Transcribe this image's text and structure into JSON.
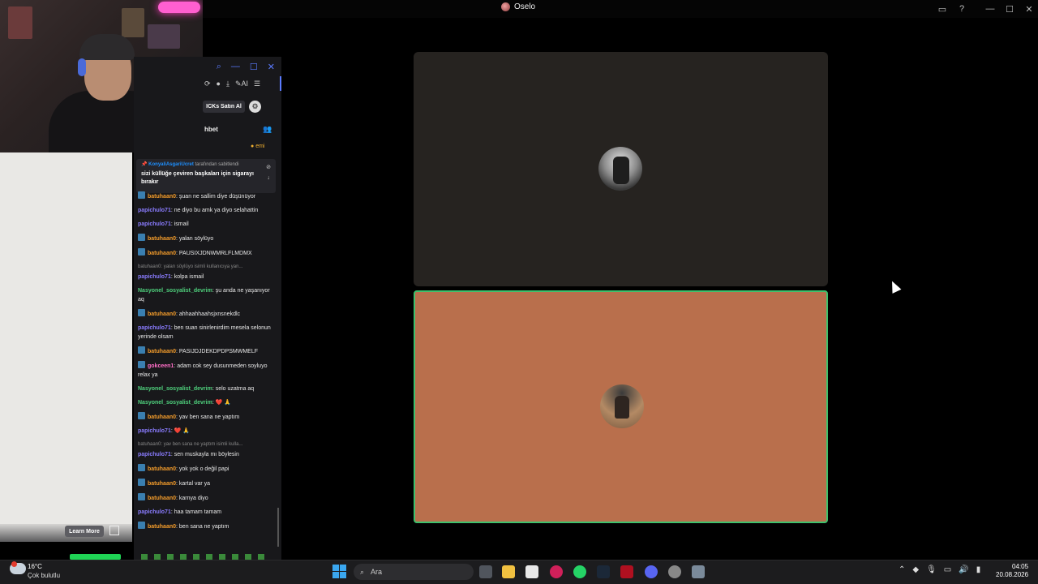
{
  "window": {
    "title": "Oselo",
    "controls": {
      "minimize": "—",
      "maximize": "☐",
      "close": "✕"
    }
  },
  "panel": {
    "buy_label": "ICKs Satın Al",
    "chat_title": "hbet",
    "points": "emi",
    "ai_label": "AI",
    "pinned": {
      "user": "KonyaliAsgariUcret",
      "suffix": "tarafından sabitlendi",
      "message": "sizi küllüğe çeviren başkaları için sigarayı bırakır"
    },
    "messages": [
      {
        "user": "batuhaan0",
        "color": "orange",
        "badge": true,
        "text": "şuan ne sallim diye düşünüyor"
      },
      {
        "user": "papichulo71",
        "color": "purple",
        "badge": false,
        "text": "ne diyo bu amk ya diyo selahattin"
      },
      {
        "user": "papichulo71",
        "color": "purple",
        "badge": false,
        "text": "ismail"
      },
      {
        "user": "batuhaan0",
        "color": "orange",
        "badge": true,
        "text": "yalan söylüyo"
      },
      {
        "user": "batuhaan0",
        "color": "orange",
        "badge": true,
        "text": "PAUSIXJDNWMRLFLMDMX"
      },
      {
        "reply": "batuhaan0: yalan söylüyo isimli kullanıcıya yan..."
      },
      {
        "user": "papichulo71",
        "color": "purple",
        "badge": false,
        "text": "kolpa ismail"
      },
      {
        "user": "Nasyonel_sosyalist_devrim",
        "color": "green",
        "badge": false,
        "text": "şu anda ne yaşanıyor aq"
      },
      {
        "user": "batuhaan0",
        "color": "orange",
        "badge": true,
        "text": "ahhaahhaahsjxnsnekdlc"
      },
      {
        "user": "papichulo71",
        "color": "purple",
        "badge": false,
        "text": "ben suan sinirlenirdim mesela selonun yerinde olsam"
      },
      {
        "user": "batuhaan0",
        "color": "orange",
        "badge": true,
        "text": "PASIJDJDEKDPDPSMWMELF"
      },
      {
        "user": "gokceen1",
        "color": "pink",
        "badge": true,
        "text": "adam cok sey dusunmeden soyluyo relax ya"
      },
      {
        "user": "Nasyonel_sosyalist_devrim",
        "color": "green",
        "badge": false,
        "text": "selo uzatma aq"
      },
      {
        "user": "Nasyonel_sosyalist_devrim",
        "color": "green",
        "badge": false,
        "text": "❤️ 🙏"
      },
      {
        "user": "batuhaan0",
        "color": "orange",
        "badge": true,
        "text": "yav ben sana ne yaptım"
      },
      {
        "user": "papichulo71",
        "color": "purple",
        "badge": false,
        "text": "❤️ 🙏"
      },
      {
        "reply": "batuhaan0: yav ben sana ne yaptım isimli kulla..."
      },
      {
        "user": "papichulo71",
        "color": "purple",
        "badge": false,
        "text": "sen muskayla mı böylesin"
      },
      {
        "user": "batuhaan0",
        "color": "orange",
        "badge": true,
        "text": "yok yok o değil papi"
      },
      {
        "user": "batuhaan0",
        "color": "orange",
        "badge": true,
        "text": "kartal var ya"
      },
      {
        "user": "batuhaan0",
        "color": "orange",
        "badge": true,
        "text": "karnya diyo"
      },
      {
        "user": "papichulo71",
        "color": "purple",
        "badge": false,
        "text": "haa tamam tamam"
      },
      {
        "user": "batuhaan0",
        "color": "orange",
        "badge": true,
        "text": "ben sana ne yaptım"
      }
    ]
  },
  "ad": {
    "learn_more": "Learn More"
  },
  "taskbar": {
    "temperature": "16°C",
    "weather": "Çok bulutlu",
    "search_placeholder": "Ara",
    "time": "04:05",
    "date": "20.08.2026"
  },
  "colors": {
    "board_dark": "#262320",
    "board_active": "#b96f4c",
    "active_border": "#3ec06c"
  },
  "icons": [
    "search-icon",
    "windows-start-icon",
    "steam-icon",
    "discord-icon",
    "whatsapp-icon",
    "file-explorer-icon",
    "settings-icon"
  ]
}
